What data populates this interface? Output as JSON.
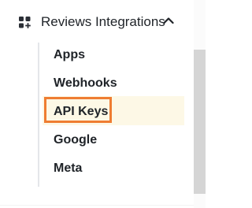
{
  "section": {
    "title": "Reviews Integrations",
    "icon": "apps-add-icon",
    "chevron_icon": "chevron-up-icon",
    "expanded": true
  },
  "nav": {
    "items": [
      {
        "label": "Apps"
      },
      {
        "label": "Webhooks"
      },
      {
        "label": "API Keys",
        "selected": true
      },
      {
        "label": "Google"
      },
      {
        "label": "Meta"
      }
    ]
  },
  "colors": {
    "text": "#1f2328",
    "selected_background": "#fdf8e6",
    "highlight_border": "#ef7d32",
    "scrollbar_thumb": "#d5d5d5"
  }
}
